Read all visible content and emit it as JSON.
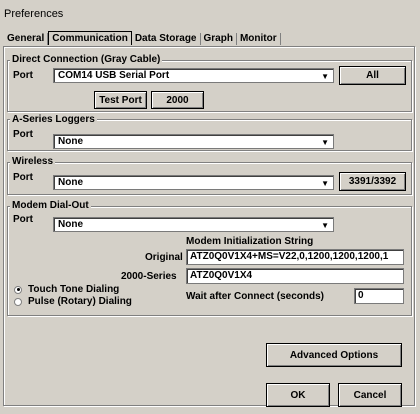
{
  "window": {
    "title": "Preferences"
  },
  "tabs": [
    {
      "label": "General"
    },
    {
      "label": "Communication"
    },
    {
      "label": "Data Storage"
    },
    {
      "label": "Graph"
    },
    {
      "label": "Monitor"
    }
  ],
  "direct": {
    "legend": "Direct Connection (Gray Cable)",
    "port_label": "Port",
    "port_value": "COM14  USB Serial Port",
    "all_button": "All",
    "test_port_button": "Test Port",
    "button_2000": "2000"
  },
  "aseries": {
    "legend": "A-Series Loggers",
    "port_label": "Port",
    "port_value": "None"
  },
  "wireless": {
    "legend": "Wireless",
    "port_label": "Port",
    "port_value": "None",
    "button": "3391/3392"
  },
  "modem": {
    "legend": "Modem Dial-Out",
    "port_label": "Port",
    "port_value": "None",
    "init_heading": "Modem Initialization String",
    "original_label": "Original",
    "original_value": "ATZ0Q0V1X4+MS=V22,0,1200,1200,1200,1",
    "series2000_label": "2000-Series",
    "series2000_value": "ATZ0Q0V1X4",
    "touch_tone": "Touch Tone Dialing",
    "pulse": "Pulse (Rotary) Dialing",
    "wait_label": "Wait after Connect (seconds)",
    "wait_value": "0"
  },
  "footer": {
    "advanced_button": "Advanced Options",
    "ok_button": "OK",
    "cancel_button": "Cancel"
  }
}
